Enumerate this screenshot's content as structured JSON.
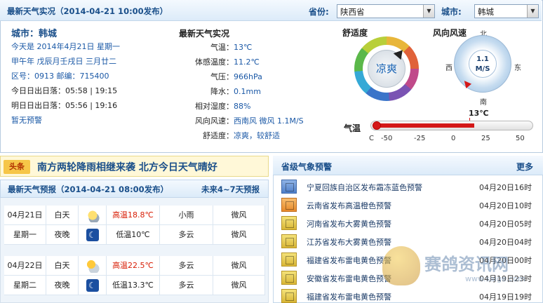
{
  "top": {
    "title": "最新天气实况（2014-04-21 10:00发布）",
    "province_label": "省份:",
    "province_value": "陕西省",
    "city_label": "城市:",
    "city_value": "韩城"
  },
  "info": {
    "city": "城市：韩城",
    "today": "今天是 2014年4月21日 星期一",
    "lunar": "甲午年 戊辰月壬戌日 三月廿二",
    "codes": "区号：0913  邮编：715400",
    "sun_today": "今日日出日落：05:58 | 19:15",
    "sun_tomorrow": "明日日出日落：05:56 | 19:16",
    "warning": "暂无预警"
  },
  "live": {
    "heading": "最新天气实况",
    "rows": [
      {
        "k": "气温：",
        "v": "13℃"
      },
      {
        "k": "体感温度：",
        "v": "11.2℃"
      },
      {
        "k": "气压：",
        "v": "966hPa"
      },
      {
        "k": "降水：",
        "v": "0.1mm"
      },
      {
        "k": "相对湿度：",
        "v": "88%"
      },
      {
        "k": "风向风速：",
        "v": "西南风 微风 1.1M/S"
      },
      {
        "k": "舒适度：",
        "v": "凉爽，较舒适"
      }
    ]
  },
  "gauges": {
    "comfort_label": "舒适度",
    "comfort_value": "凉爽",
    "wind_label": "风向风速",
    "wind_value": "1.1",
    "wind_unit": "M/S",
    "north": "北",
    "south": "南",
    "east": "东",
    "west": "西",
    "temp_label": "气温",
    "temp_value": "13℃",
    "temp_fraction": 0.63,
    "unit_c": "C",
    "ticks": [
      "-50",
      "-25",
      "0",
      "25",
      "50"
    ]
  },
  "headline": {
    "tag": "头条",
    "text": "南方两轮降雨相继来袭 北方今日天气晴好"
  },
  "forecast": {
    "title": "最新天气预报（2014-04-21 08:00发布）",
    "more": "未来4~7天预报",
    "days": [
      {
        "date": "04月21日",
        "weekday": "星期一",
        "day": {
          "label": "白天",
          "temp": "高温18.8℃",
          "weather": "小雨",
          "wind": "微风",
          "icon": "rain-icon"
        },
        "night": {
          "label": "夜晚",
          "temp": "低温10℃",
          "weather": "多云",
          "wind": "微风",
          "icon": "moon-icon"
        }
      },
      {
        "date": "04月22日",
        "weekday": "星期二",
        "day": {
          "label": "白天",
          "temp": "高温22.5℃",
          "weather": "多云",
          "wind": "微风",
          "icon": "sun-cloud-icon"
        },
        "night": {
          "label": "夜晚",
          "temp": "低温13.3℃",
          "weather": "多云",
          "wind": "微风",
          "icon": "moon-icon"
        }
      }
    ]
  },
  "alerts": {
    "title": "省级气象预警",
    "more": "更多",
    "items": [
      {
        "text": "宁夏回族自治区发布霜冻蓝色预警",
        "date": "04月20日16时",
        "level": "blue"
      },
      {
        "text": "云南省发布高温橙色预警",
        "date": "04月20日10时",
        "level": "orange"
      },
      {
        "text": "河南省发布大雾黄色预警",
        "date": "04月20日05时",
        "level": "yellow"
      },
      {
        "text": "江苏省发布大雾黄色预警",
        "date": "04月20日04时",
        "level": "yellow"
      },
      {
        "text": "福建省发布雷电黄色预警",
        "date": "04月20日00时",
        "level": "yellow"
      },
      {
        "text": "安徽省发布雷电黄色预警",
        "date": "04月19日23时",
        "level": "yellow"
      },
      {
        "text": "福建省发布雷电黄色预警",
        "date": "04月19日19时",
        "level": "yellow"
      }
    ]
  },
  "watermark": {
    "text": "赛鸽资讯网",
    "url": "www.saige.com"
  }
}
